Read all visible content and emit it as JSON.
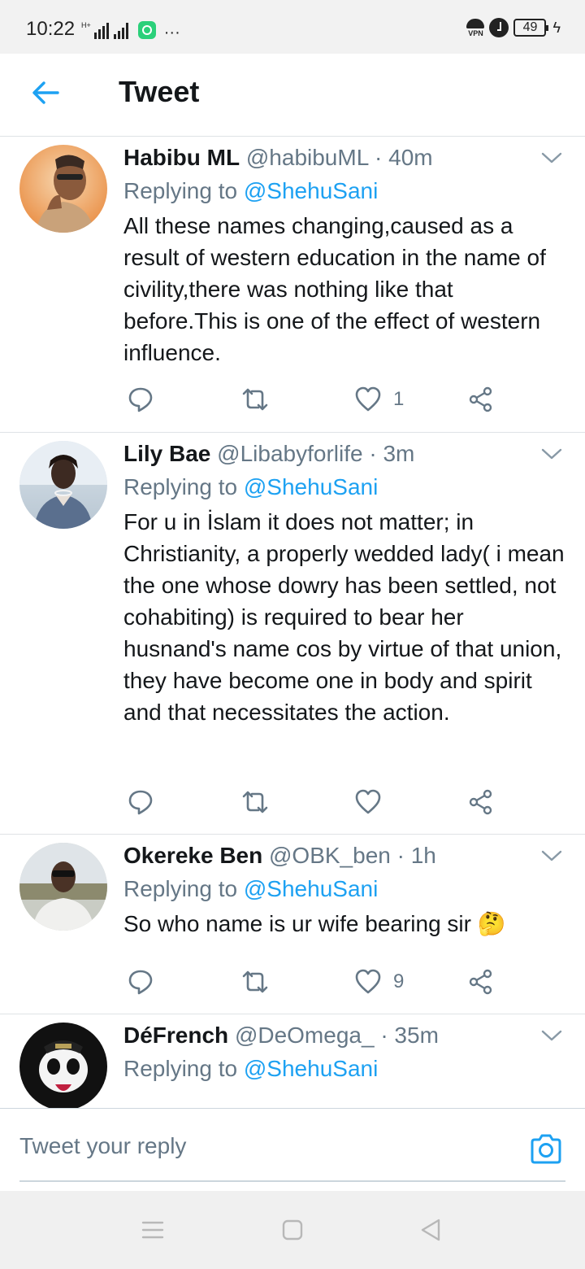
{
  "status_bar": {
    "time": "10:22",
    "network_type": "H+",
    "vpn_label": "VPN",
    "battery": "49"
  },
  "header": {
    "title": "Tweet"
  },
  "tweets": [
    {
      "name": "Habibu ML",
      "handle": "@habibuML",
      "time": "· 40m",
      "replying_prefix": "Replying to",
      "replying_to": "@ShehuSani",
      "text": "All these names changing,caused as a result of western education in the name of civility,there was nothing like that before.This is one of the effect of western influence.",
      "likes": "1"
    },
    {
      "name": "Lily Bae",
      "handle": "@Libabyforlife",
      "time": "· 3m",
      "replying_prefix": "Replying to",
      "replying_to": "@ShehuSani",
      "text": "For u in İslam it does not matter; in Christianity, a properly wedded lady( i mean the one whose dowry has been settled, not cohabiting) is required to bear her husnand's name cos by virtue of that union, they have become one in body and spirit and that necessitates the action.",
      "likes": ""
    },
    {
      "name": "Okereke Ben",
      "handle": "@OBK_ben",
      "time": "· 1h",
      "replying_prefix": "Replying to",
      "replying_to": "@ShehuSani",
      "text": "So who name is ur wife bearing sir 🤔",
      "likes": "9"
    },
    {
      "name": "DéFrench",
      "handle": "@DeOmega_",
      "time": "· 35m",
      "replying_prefix": "Replying to",
      "replying_to": "@ShehuSani",
      "text": "",
      "likes": ""
    }
  ],
  "reply_bar": {
    "placeholder": "Tweet your reply"
  },
  "colors": {
    "accent": "#1da1f2",
    "secondary_text": "#657786",
    "primary_text": "#14171a",
    "divider": "#dfe3e6"
  }
}
